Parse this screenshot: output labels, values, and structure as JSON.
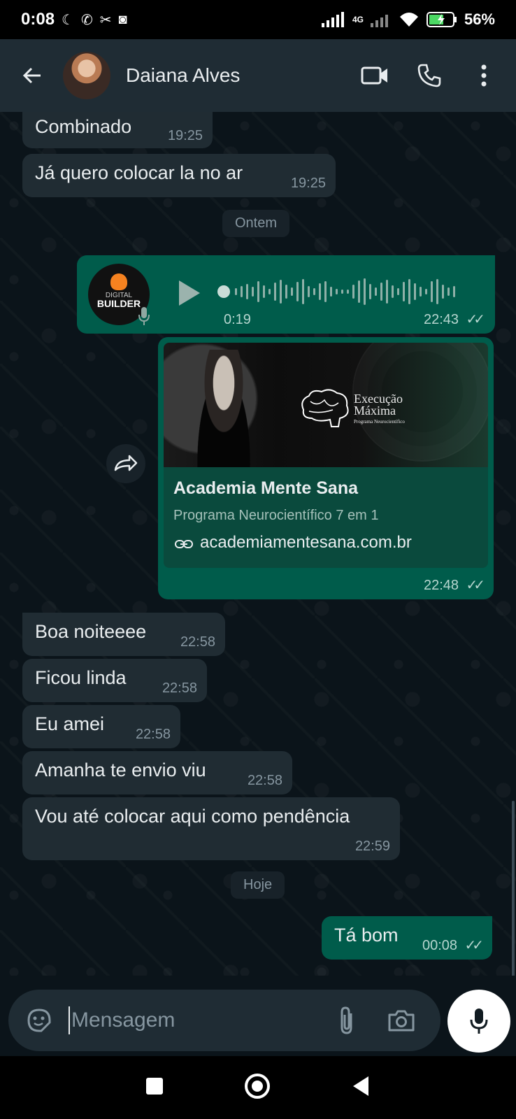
{
  "status_bar": {
    "time": "0:08",
    "network": "4G",
    "battery": "56%"
  },
  "header": {
    "contact_name": "Daiana Alves"
  },
  "messages": {
    "m1": {
      "text": "Combinado",
      "time": "19:25"
    },
    "m2": {
      "text": "Já quero colocar la no ar",
      "time": "19:25"
    },
    "date1": "Ontem",
    "audio": {
      "duration": "0:19",
      "time": "22:43",
      "avatar_top": "DIGITAL",
      "avatar_bottom": "BUILDER"
    },
    "link": {
      "banner_title_1": "Execução",
      "banner_title_2": "Máxima",
      "banner_sub": "Programa Neurocientífico",
      "title": "Academia Mente Sana",
      "description": "Programa Neurocientífico 7 em 1",
      "url": "academiamentesana.com.br",
      "time": "22:48"
    },
    "m3": {
      "text": "Boa noiteeee",
      "time": "22:58"
    },
    "m4": {
      "text": "Ficou linda",
      "time": "22:58"
    },
    "m5": {
      "text": "Eu amei",
      "time": "22:58"
    },
    "m6": {
      "text": "Amanha te envio viu",
      "time": "22:58"
    },
    "m7": {
      "text": "Vou até colocar aqui como pendência",
      "time": "22:59"
    },
    "date2": "Hoje",
    "m8": {
      "text": "Tá bom",
      "time": "00:08"
    }
  },
  "composer": {
    "placeholder": "Mensagem"
  },
  "colors": {
    "incoming": "#202c33",
    "outgoing": "#005c4b",
    "background": "#0b141a",
    "header": "#1f2c34"
  }
}
